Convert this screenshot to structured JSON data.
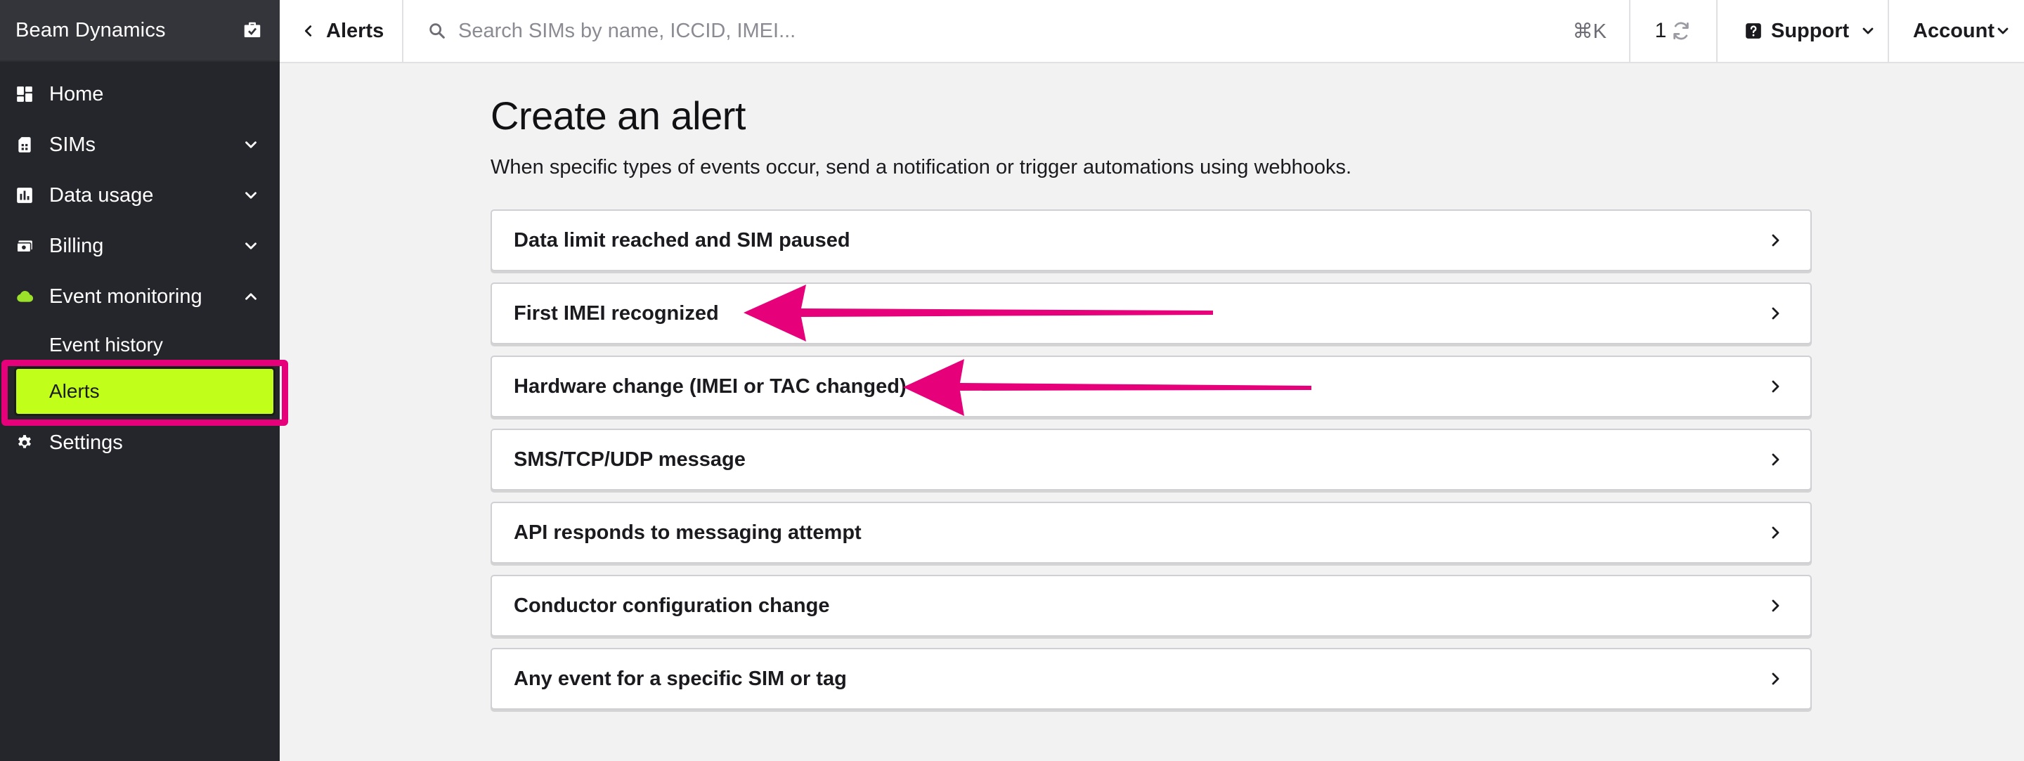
{
  "sidebar": {
    "org_name": "Beam Dynamics",
    "nav": [
      {
        "label": "Home",
        "icon": "grid-icon"
      },
      {
        "label": "SIMs",
        "icon": "sim-card-icon"
      },
      {
        "label": "Data usage",
        "icon": "bar-chart-icon"
      },
      {
        "label": "Billing",
        "icon": "money-icon"
      },
      {
        "label": "Event monitoring",
        "icon": "cloud-icon",
        "accent": "#c1ff1a"
      },
      {
        "label": "Settings",
        "icon": "gear-icon"
      }
    ],
    "sub_items": [
      {
        "label": "Event history"
      },
      {
        "label": "Alerts",
        "active": true
      }
    ]
  },
  "header": {
    "back_label": "Alerts",
    "search_placeholder": "Search SIMs by name, ICCID, IMEI...",
    "shortcut": "⌘K",
    "sync_count": "1",
    "support_label": "Support",
    "account_label": "Account"
  },
  "main": {
    "title": "Create an alert",
    "description": "When specific types of events occur, send a notification or trigger automations using webhooks.",
    "options": [
      {
        "label": "Data limit reached and SIM paused"
      },
      {
        "label": "First IMEI recognized"
      },
      {
        "label": "Hardware change (IMEI or TAC changed)"
      },
      {
        "label": "SMS/TCP/UDP message"
      },
      {
        "label": "API responds to messaging attempt"
      },
      {
        "label": "Conductor configuration change"
      },
      {
        "label": "Any event for a specific SIM or tag"
      }
    ]
  },
  "colors": {
    "sidebar_bg": "#25262b",
    "active_bg": "#c1ff1a",
    "annotation": "#e6007a"
  }
}
